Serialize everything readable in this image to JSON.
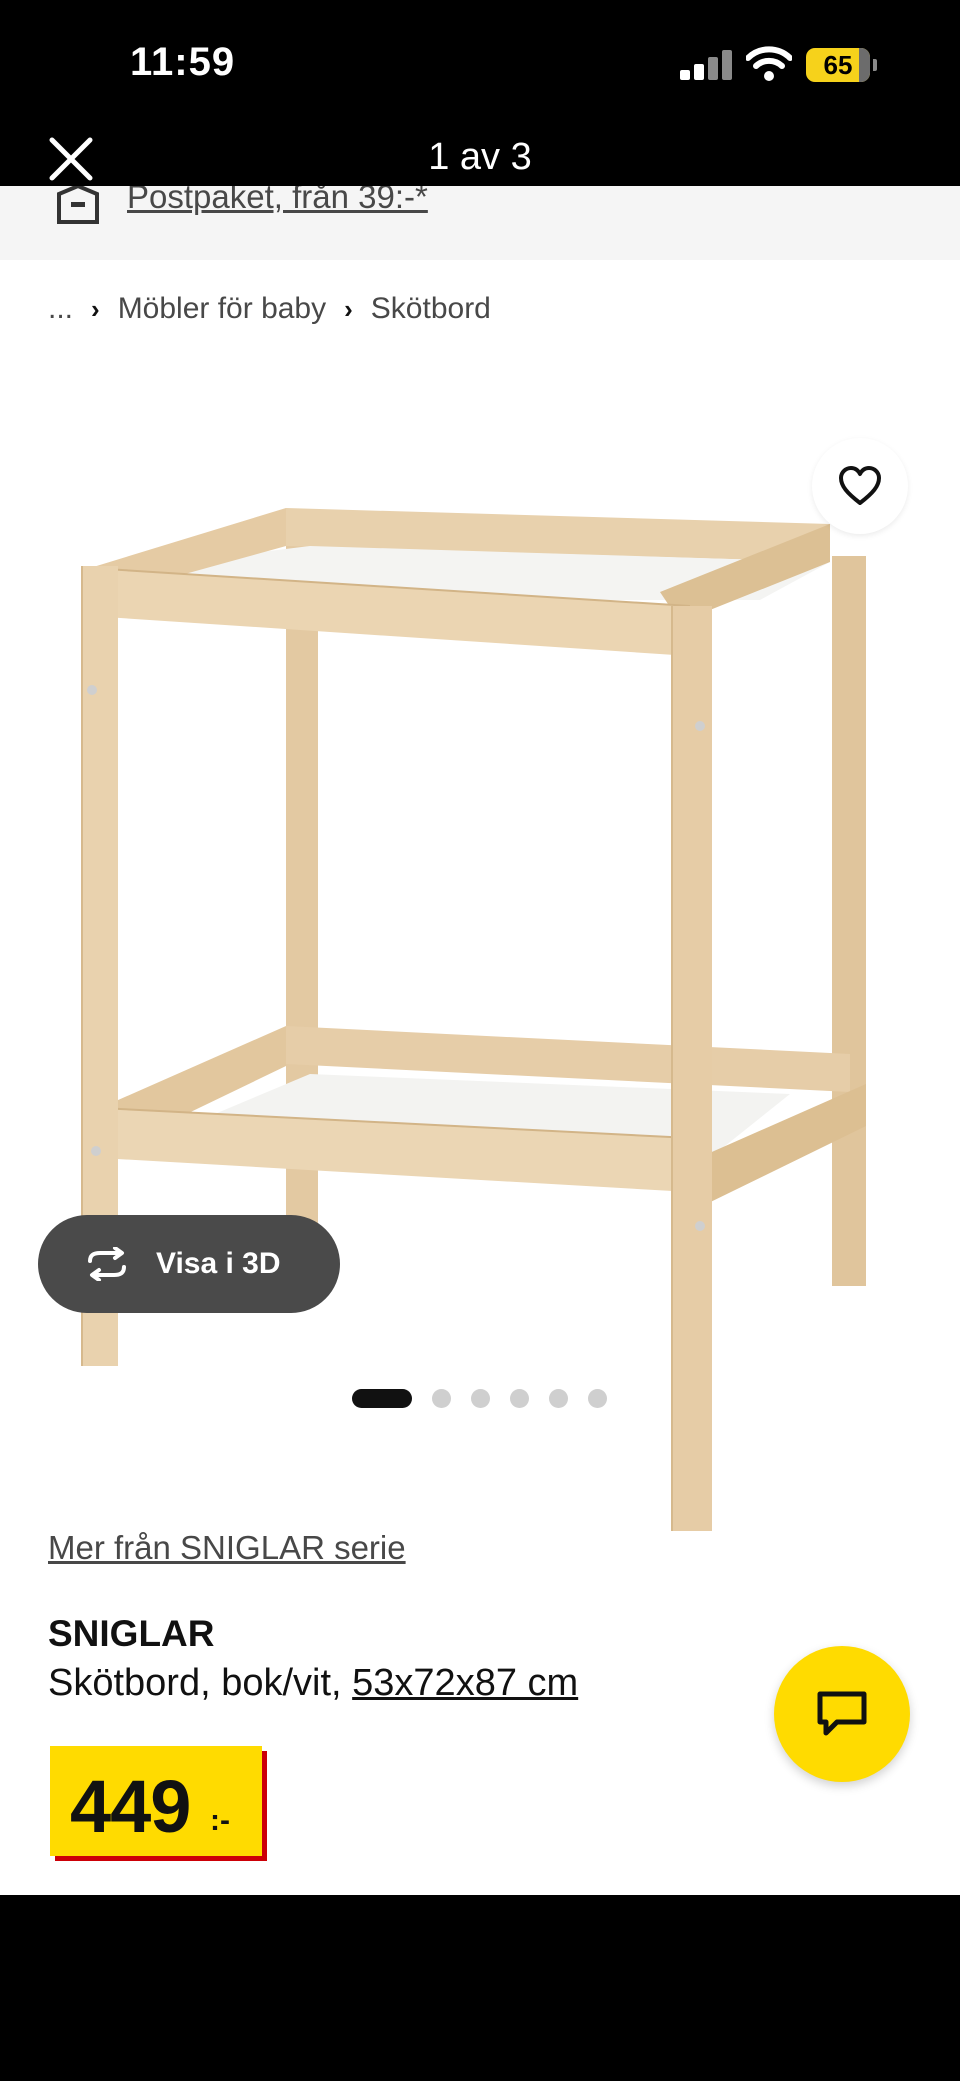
{
  "status": {
    "time": "11:59",
    "battery_level": "65",
    "battery_color": "#f6d21b"
  },
  "nav": {
    "title": "1 av 3",
    "close_icon": "close-icon"
  },
  "shipping": {
    "link_text": "Postpaket, från 39:-*",
    "icon": "box-icon"
  },
  "breadcrumb": {
    "items": [
      "...",
      "Möbler för baby",
      "Skötbord"
    ],
    "separator_icon": "chevron-right-icon"
  },
  "gallery": {
    "image_label": "changing-table-image",
    "view3d_label": "Visa i 3D",
    "view3d_icon": "rotate-3d-icon",
    "favorite_icon": "heart-icon",
    "dot_count": 6,
    "active_dot": 0
  },
  "product": {
    "series_link": "Mer från SNIGLAR serie",
    "name": "SNIGLAR",
    "desc_prefix": "Skötbord, bok/vit, ",
    "dimensions": "53x72x87 cm",
    "price": "449",
    "price_suffix": ":-"
  },
  "chat": {
    "icon": "chat-icon",
    "color": "#ffdb00"
  },
  "colors": {
    "brand_yellow": "#ffdb00",
    "brand_red": "#cc0008",
    "text": "#111111",
    "muted_text": "#484848"
  }
}
